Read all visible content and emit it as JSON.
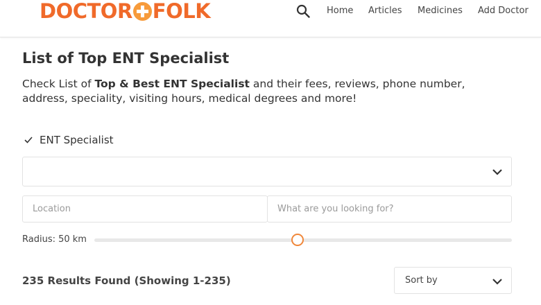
{
  "header": {
    "logo_left": "DOCTOR",
    "logo_right": "FOLK",
    "nav": [
      "Home",
      "Articles",
      "Medicines",
      "Add Doctor"
    ]
  },
  "main": {
    "title": "List of Top ENT Specialist",
    "desc_prefix": "Check List of ",
    "desc_bold": "Top & Best ENT Specialist",
    "desc_suffix": " and their fees, reviews, phone number, address, speciality, visiting hours, medical degrees and more!",
    "category_checkbox": {
      "label": "ENT Specialist",
      "checked": true
    },
    "category_select": {
      "value": ""
    },
    "location_input": {
      "placeholder": "Location",
      "value": ""
    },
    "search_input": {
      "placeholder": "What are you looking for?",
      "value": ""
    },
    "radius": {
      "label": "Radius: 50 km",
      "value_km": 50,
      "slider_fraction": 0.5
    },
    "results_text": "235 Results Found (Showing 1-235)",
    "sort": {
      "label": "Sort by"
    }
  },
  "colors": {
    "brand_orange": "#f06a2a",
    "slider_accent": "#f0873a"
  },
  "icons": {
    "search": "search-icon",
    "checkbox": "checkmark-icon",
    "dropdown": "chevron-down-icon"
  }
}
